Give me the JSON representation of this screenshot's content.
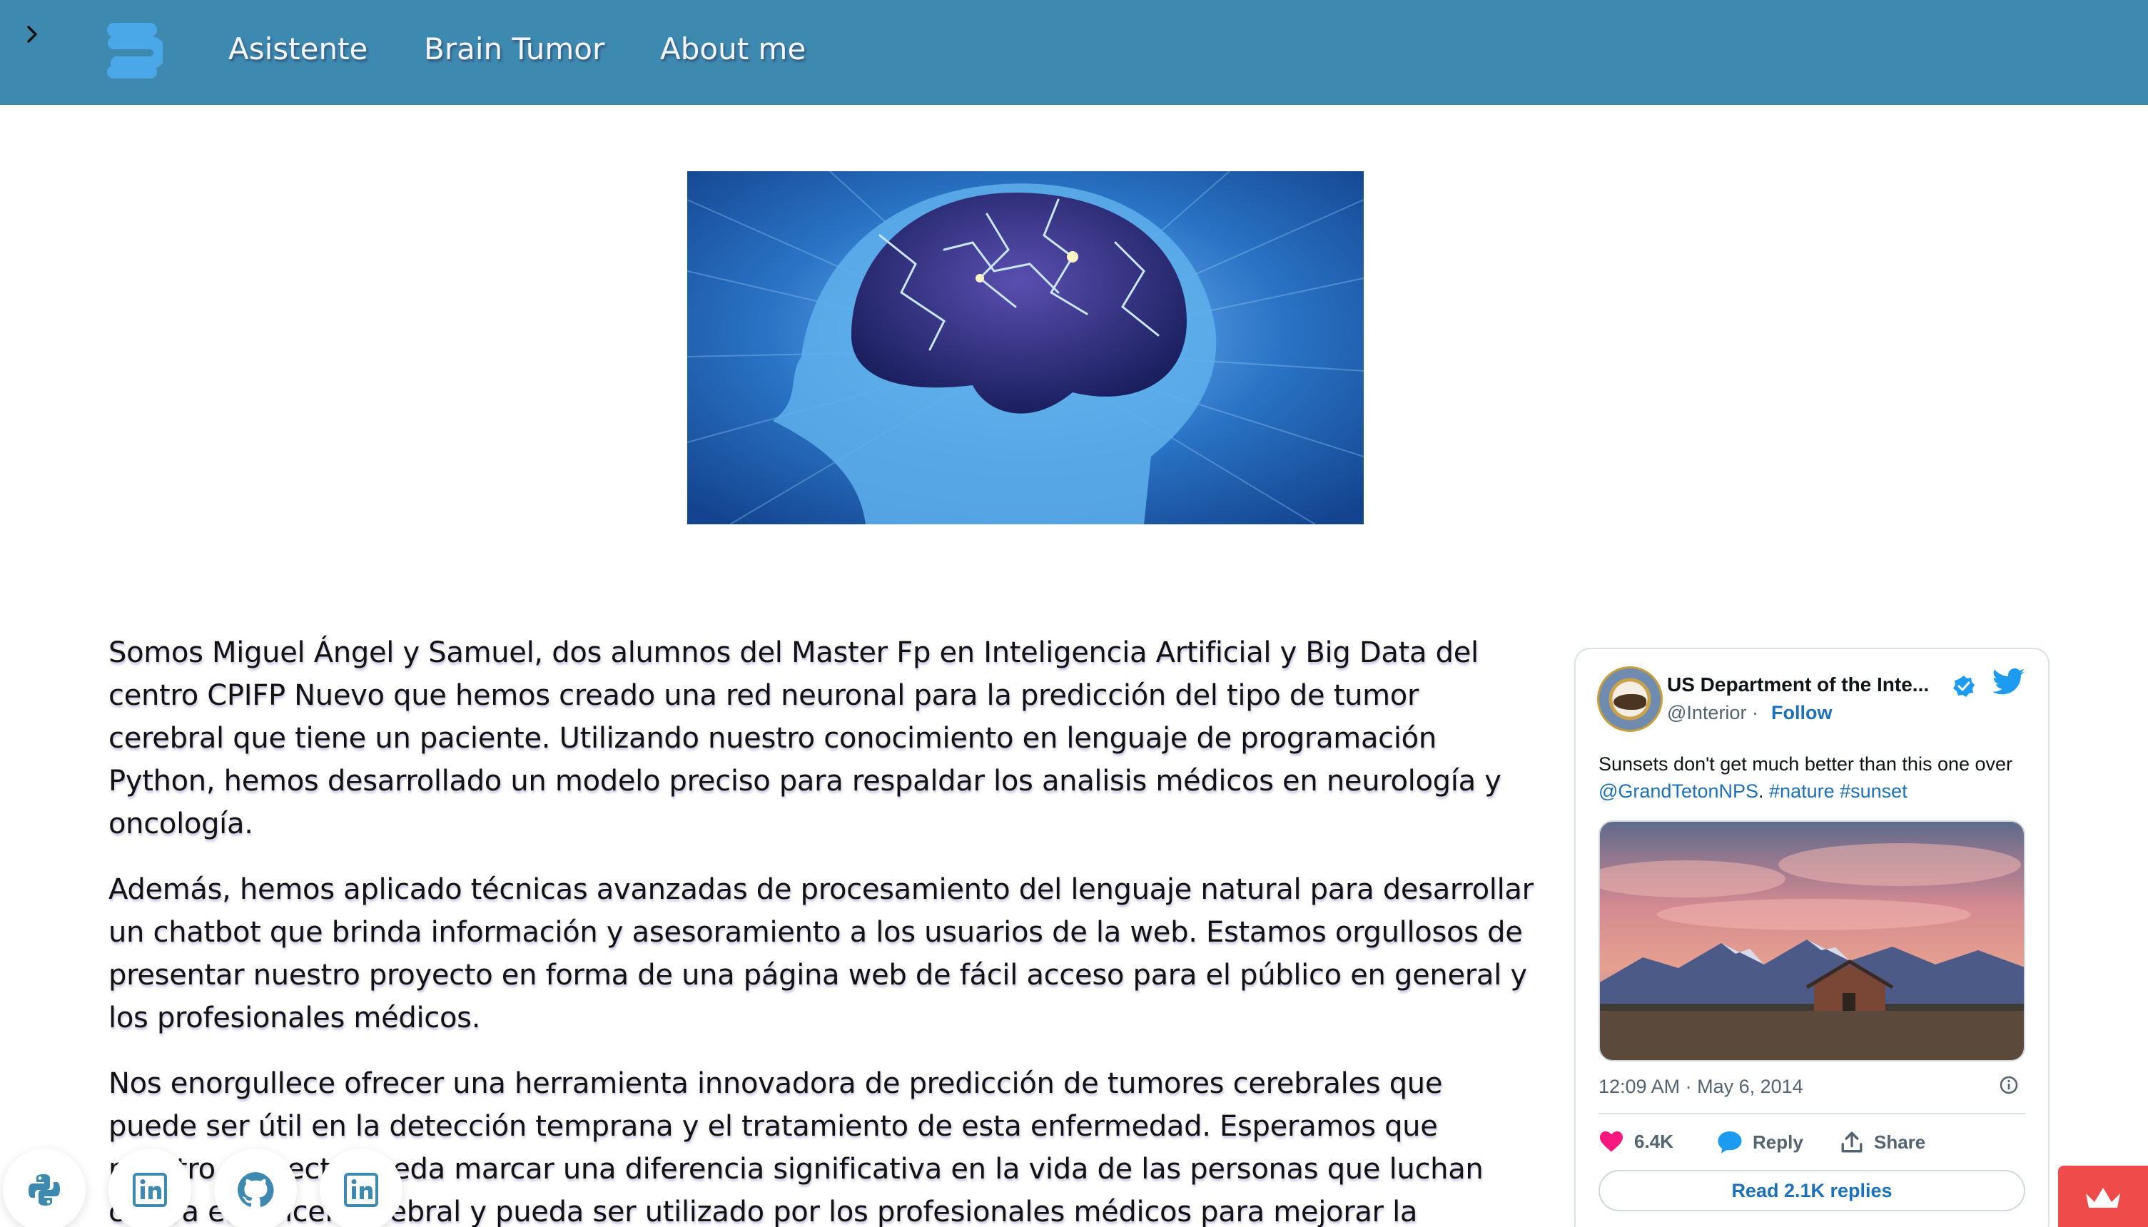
{
  "header": {
    "nav": [
      {
        "label": "Asistente"
      },
      {
        "label": "Brain Tumor"
      },
      {
        "label": "About me"
      }
    ]
  },
  "content": {
    "paragraphs": [
      "Somos Miguel Ángel y Samuel, dos alumnos del Master Fp en Inteligencia Artificial y Big Data del centro CPIFP Nuevo que hemos creado una red neuronal para la predicción del tipo de tumor cerebral que tiene un paciente. Utilizando nuestro conocimiento en lenguaje de programación Python, hemos desarrollado un modelo preciso para respaldar los analisis médicos en neurología y oncología.",
      "Además, hemos aplicado técnicas avanzadas de procesamiento del lenguaje natural para desarrollar un chatbot que brinda información y asesoramiento a los usuarios de la web. Estamos orgullosos de presentar nuestro proyecto en forma de una página web de fácil acceso para el público en general y los profesionales médicos.",
      "Nos enorgullece ofrecer una herramienta innovadora de predicción de tumores cerebrales que puede ser útil en la detección temprana y el tratamiento de esta enfermedad. Esperamos que nuestro proyecto pueda marcar una diferencia significativa en la vida de las personas que luchan contra el cáncer cerebral y pueda ser utilizado por los profesionales médicos para mejorar la"
    ]
  },
  "tweet": {
    "name": "US Department of the Inte...",
    "handle": "@Interior",
    "separator": "·",
    "follow_label": "Follow",
    "text_prefix": "Sunsets don't get much better than this one over ",
    "mention": "@GrandTetonNPS",
    "text_mid": ". ",
    "hashtag1": "#nature",
    "hashtag2": "#sunset",
    "timestamp": "12:09 AM · May 6, 2014",
    "likes": "6.4K",
    "reply_label": "Reply",
    "share_label": "Share",
    "read_replies_label": "Read 2.1K replies"
  },
  "icons": {
    "sidebar_toggle": "chevron-right-icon",
    "logo": "streamlit-logo",
    "social": [
      "python-icon",
      "linkedin-icon",
      "github-icon",
      "linkedin-icon"
    ],
    "badge": "crown-icon"
  },
  "colors": {
    "header": "#3d89b0",
    "link": "#1d71b8",
    "like": "#f91880",
    "badge": "#ef4b4b"
  }
}
